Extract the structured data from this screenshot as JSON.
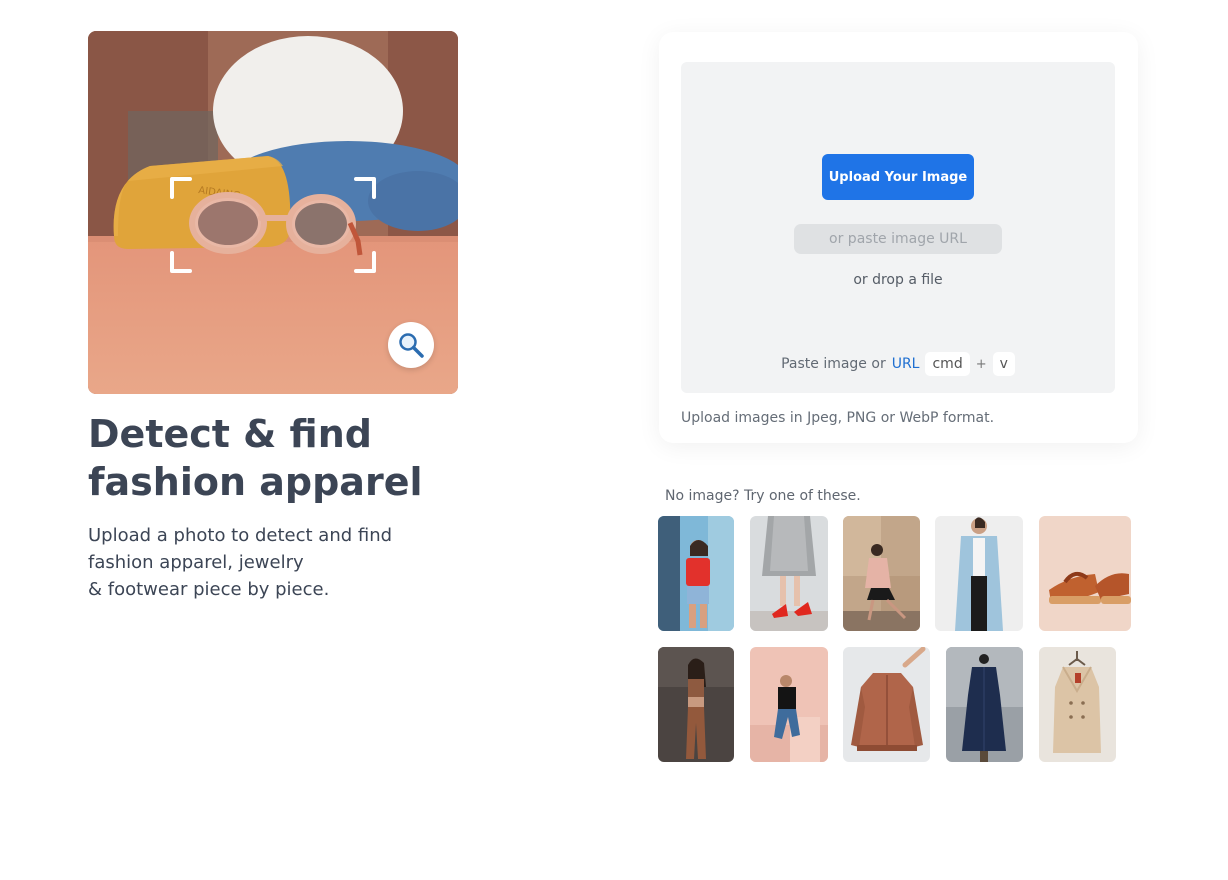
{
  "hero": {
    "title_line1": "Detect & find",
    "title_line2": "fashion apparel",
    "subtitle_line1": "Upload a photo to detect and find",
    "subtitle_line2": "fashion apparel, jewelry",
    "subtitle_line3": "& footwear piece by piece.",
    "bag_text": "AIDAING",
    "zoom_icon": "magnifier-icon"
  },
  "upload": {
    "button_label": "Upload Your Image",
    "url_placeholder": "or paste image URL",
    "drop_text": "or drop a file",
    "paste_prefix": "Paste image or",
    "paste_link": "URL",
    "key_cmd": "cmd",
    "key_plus": "+",
    "key_v": "v",
    "formats_note": "Upload images in Jpeg, PNG or WebP format."
  },
  "samples": {
    "label": "No image? Try one of these.",
    "items": [
      "street-style-red-tee-denim-shorts",
      "grey-skirt-red-heels",
      "pink-coat-black-skirt",
      "light-blue-coat",
      "brown-platform-sandals",
      "brown-athletic-set",
      "black-tee-blue-jeans",
      "brown-bomber-jacket",
      "navy-dress-mannequin",
      "beige-trench-coat"
    ]
  },
  "colors": {
    "primary": "#1f74e7",
    "text": "#3c4555",
    "dropzone_bg": "#f2f3f4",
    "link": "#1f6fd1"
  }
}
